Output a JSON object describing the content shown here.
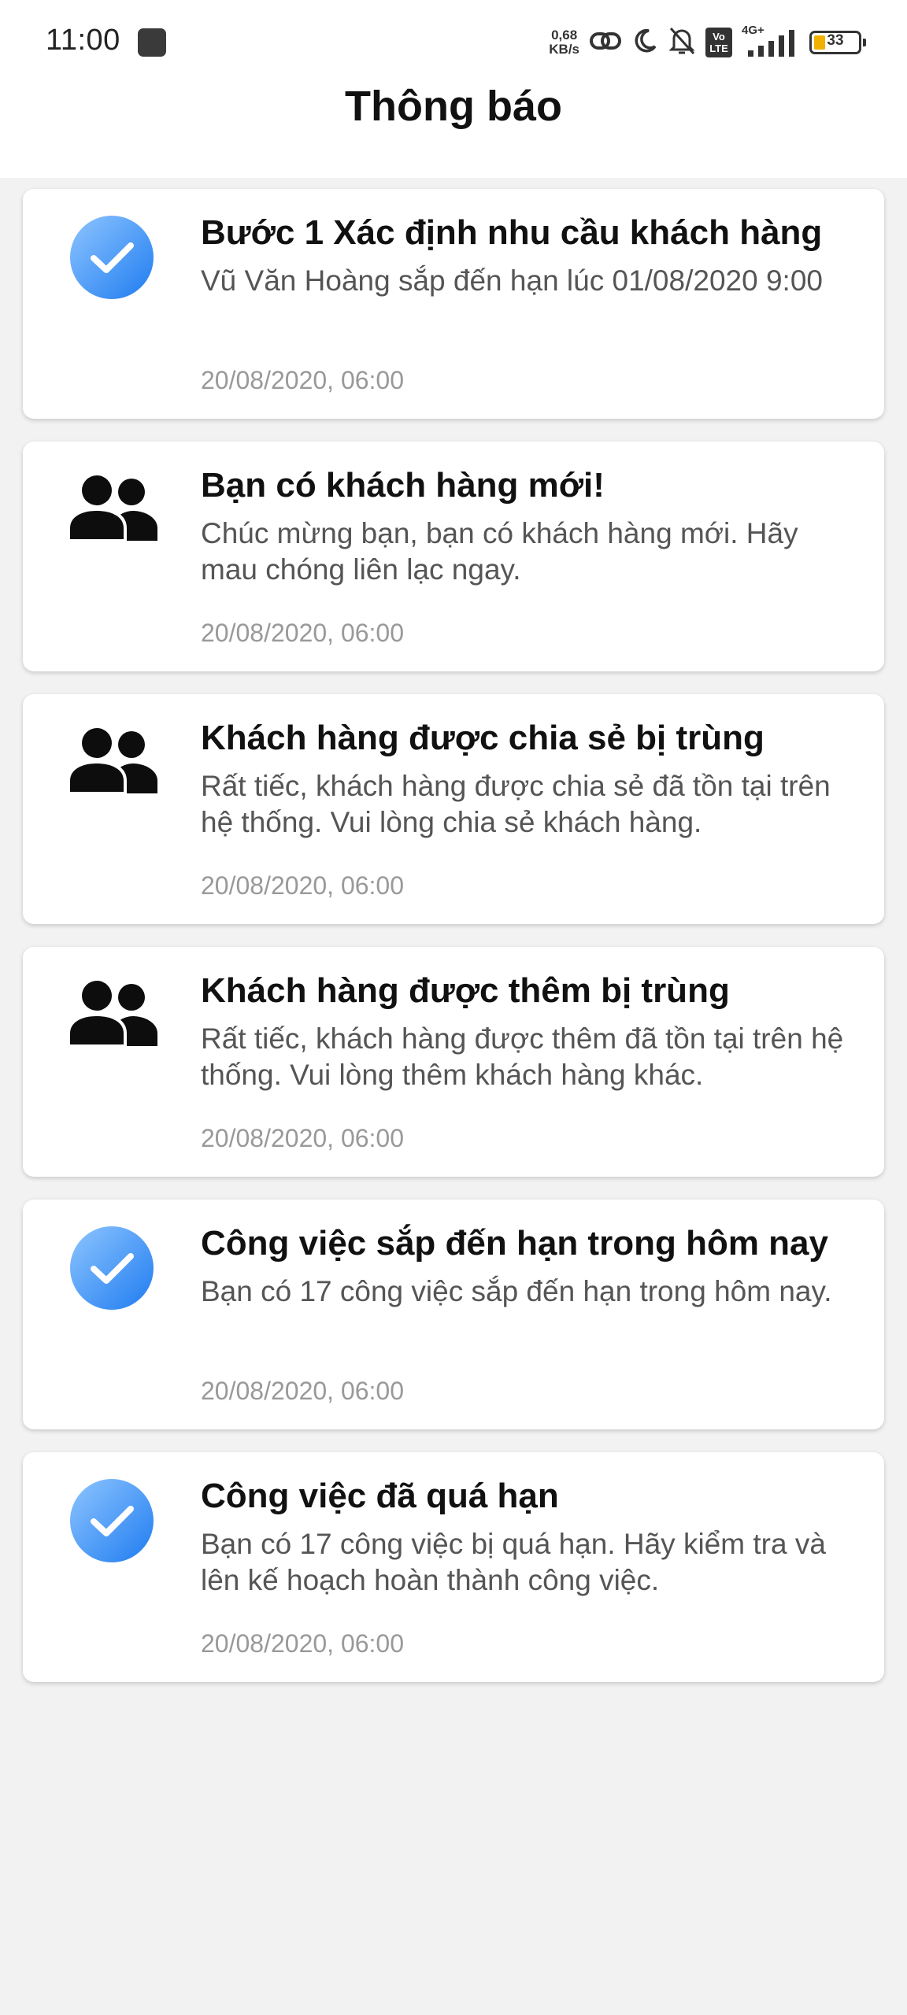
{
  "status_bar": {
    "time": "11:00",
    "net_speed_value": "0,68",
    "net_speed_unit": "KB/s",
    "vo_label": "Vo",
    "lte_label": "LTE",
    "network_type": "4G+",
    "battery_level": "33"
  },
  "header": {
    "title": "Thông báo"
  },
  "notifications": [
    {
      "icon": "check-circle-icon",
      "title": "Bước 1 Xác định nhu cầu khách hàng",
      "message": "Vũ Văn Hoàng sắp đến hạn lúc 01/08/2020 9:00",
      "time": "20/08/2020, 06:00"
    },
    {
      "icon": "users-icon",
      "title": "Bạn có khách hàng mới!",
      "message": "Chúc mừng bạn, bạn có khách hàng mới. Hãy mau chóng liên lạc ngay.",
      "time": "20/08/2020, 06:00"
    },
    {
      "icon": "users-icon",
      "title": "Khách hàng được chia sẻ bị trùng",
      "message": "Rất tiếc, khách hàng được chia sẻ đã tồn tại trên hệ thống. Vui lòng chia sẻ khách hàng.",
      "time": "20/08/2020, 06:00"
    },
    {
      "icon": "users-icon",
      "title": "Khách hàng được thêm bị trùng",
      "message": "Rất tiếc, khách hàng được thêm đã tồn tại trên hệ thống. Vui lòng thêm khách hàng khác.",
      "time": "20/08/2020, 06:00"
    },
    {
      "icon": "check-circle-icon",
      "title": "Công việc sắp đến hạn trong hôm nay",
      "message": "Bạn có 17 công việc sắp đến hạn trong hôm nay.",
      "time": "20/08/2020, 06:00"
    },
    {
      "icon": "check-circle-icon",
      "title": "Công việc đã quá hạn",
      "message": "Bạn có 17 công việc bị quá hạn. Hãy kiểm tra và lên kế hoạch hoàn thành công việc.",
      "time": "20/08/2020, 06:00"
    }
  ],
  "colors": {
    "check_gradient_light": "#8ec5ff",
    "check_gradient_dark": "#1f7cf0",
    "users_icon": "#0d0d0d",
    "background": "#f2f2f2",
    "battery_fill": "#f2b100"
  }
}
